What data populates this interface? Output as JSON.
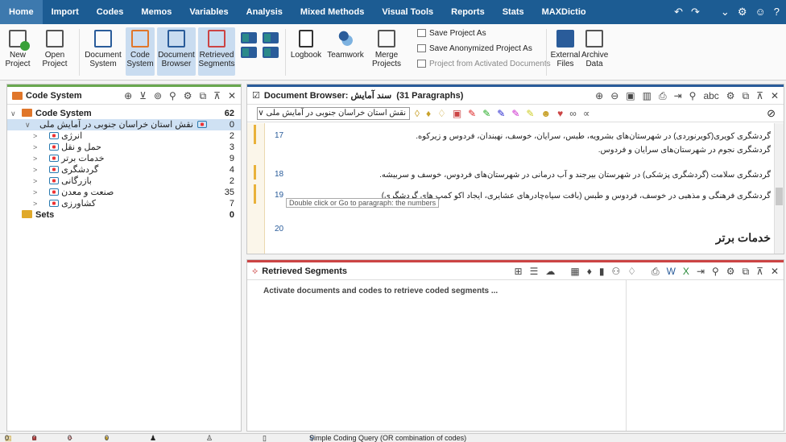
{
  "menu": {
    "tabs": [
      "Home",
      "Import",
      "Codes",
      "Memos",
      "Variables",
      "Analysis",
      "Mixed Methods",
      "Visual Tools",
      "Reports",
      "Stats",
      "MAXDictio"
    ],
    "active": "Home"
  },
  "ribbon": {
    "new_project": [
      "New",
      "Project"
    ],
    "open_project": [
      "Open",
      "Project"
    ],
    "document_system": [
      "Document",
      "System"
    ],
    "code_system": [
      "Code",
      "System"
    ],
    "document_browser": [
      "Document",
      "Browser"
    ],
    "retrieved_segments": [
      "Retrieved",
      "Segments"
    ],
    "logbook": "Logbook",
    "teamwork": "Teamwork",
    "merge_projects": [
      "Merge",
      "Projects"
    ],
    "save_project_as": "Save Project As",
    "save_anonymized": "Save Anonymized Project As",
    "project_from_activated": "Project from Activated Documents",
    "external_files": [
      "External",
      "Files"
    ],
    "archive_data": [
      "Archive",
      "Data"
    ]
  },
  "code_system": {
    "title": "Code System",
    "root": {
      "label": "Code System",
      "count": "62"
    },
    "parent": {
      "label": "نقش استان خراسان جنوبی در آمایش ملی",
      "count": "0"
    },
    "children": [
      {
        "label": "انرژی",
        "count": "2"
      },
      {
        "label": "حمل و نقل",
        "count": "3"
      },
      {
        "label": "خدمات برتر",
        "count": "9"
      },
      {
        "label": "گردشگری",
        "count": "4"
      },
      {
        "label": "بازرگانی",
        "count": "2"
      },
      {
        "label": "صنعت و معدن",
        "count": "35"
      },
      {
        "label": "کشاورزی",
        "count": "7"
      }
    ],
    "sets": {
      "label": "Sets",
      "count": "0"
    }
  },
  "document_browser": {
    "title": "Document Browser: سند آمایش",
    "paragraphs_info": "(31 Paragraphs)",
    "selected_document": "نقش استان خراسان جنوبی در آمایش ملی",
    "paragraphs": [
      {
        "num": "17",
        "lines": [
          "گردشگری کویری(کویرنوردی) در شهرستان‌های بشرویه، طبس، سرایان، خوسف، نهبندان، فردوس و زیرکوه.",
          "گردشگری نجوم در شهرستان‌های سرایان و فردوس."
        ]
      },
      {
        "num": "18",
        "lines": [
          "گردشگری سلامت (گردشگری پزشکی) در شهرستان بیرجند و آب درمانی در شهرستان‌های فردوس، خوسف و سربیشه."
        ]
      },
      {
        "num": "19",
        "lines": [
          "گردشگری فرهنگی و مذهبی در خوسف، فردوس و طبس (بافت سیاه‌چادرهای عشایری، ایجاد اکو کمپ های گردشگری)"
        ]
      },
      {
        "num": "20",
        "lines": []
      }
    ],
    "heading": "خدمات برتر",
    "tooltip": "Double click or Go to paragraph: the numbers"
  },
  "retrieved_segments": {
    "title": "Retrieved Segments",
    "message": "Activate documents and codes to retrieve coded segments ..."
  },
  "status_bar": {
    "docs": "0",
    "codes": "0",
    "segments": "0",
    "memos": "0",
    "query": "Simple Coding Query (OR combination of codes)"
  }
}
